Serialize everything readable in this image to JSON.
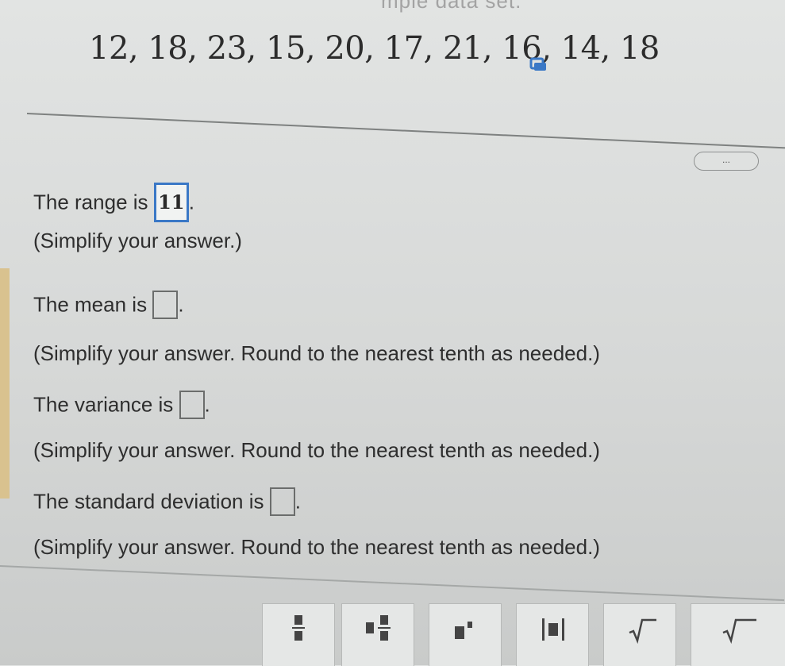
{
  "header": {
    "title_fragment": "mple data set."
  },
  "dataset": {
    "values": "12, 18, 23, 15, 20, 17, 21, 16, 14, 18"
  },
  "more_button": {
    "label": "..."
  },
  "questions": {
    "range": {
      "label": "The range is",
      "value": "11",
      "suffix": ".",
      "note": "(Simplify your answer.)"
    },
    "mean": {
      "label": "The mean is",
      "value": "",
      "suffix": ".",
      "note": "(Simplify your answer. Round to the nearest tenth as needed.)"
    },
    "variance": {
      "label": "The variance is",
      "value": "",
      "suffix": ".",
      "note": "(Simplify your answer. Round to the nearest tenth as needed.)"
    },
    "std_dev": {
      "label": "The standard deviation is",
      "value": "",
      "suffix": ".",
      "note": "(Simplify your answer. Round to the nearest tenth as needed.)"
    }
  },
  "toolbar": {
    "buttons": [
      "fraction-icon",
      "mixed-number-icon",
      "exponent-icon",
      "absolute-value-icon",
      "square-root-icon",
      "nth-root-icon"
    ]
  },
  "colors": {
    "accent": "#3a78c6"
  }
}
